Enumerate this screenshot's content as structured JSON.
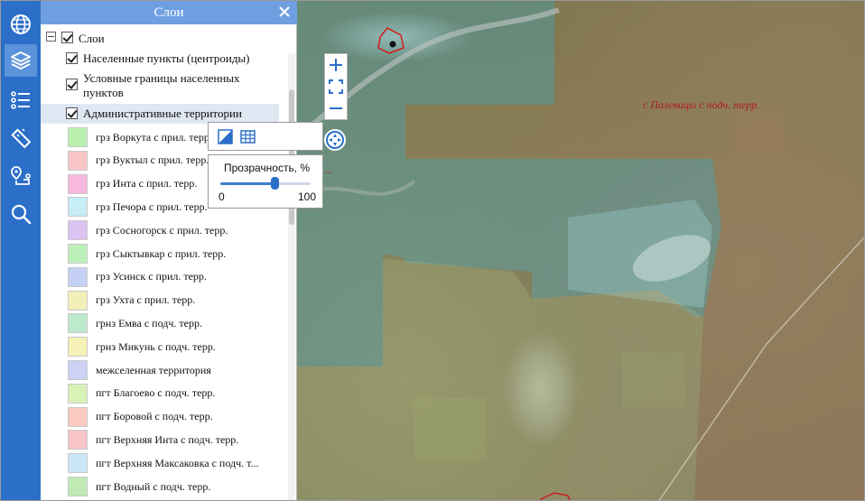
{
  "panel": {
    "title": "Слои",
    "root_label": "Слои",
    "layers": [
      {
        "label": "Населенные пункты (центроиды)"
      },
      {
        "label": "Условные границы населенных пунктов"
      },
      {
        "label": "Административные территории"
      }
    ]
  },
  "legend": [
    {
      "label": "грз Воркута с прил. терр.",
      "color": "#b9f0b0"
    },
    {
      "label": "грз Вуктыл с прил. терр.",
      "color": "#f9c6c6"
    },
    {
      "label": "грз Инта с прил. терр.",
      "color": "#f7b8de"
    },
    {
      "label": "грз Печора с прил. терр.",
      "color": "#c6eef4"
    },
    {
      "label": "грз Сосногорск с прил. терр.",
      "color": "#dcc3f2"
    },
    {
      "label": "грз Сыктывкар с прил. терр.",
      "color": "#bdefb9"
    },
    {
      "label": "грз Усинск с прил. терр.",
      "color": "#c5d1f4"
    },
    {
      "label": "грз Ухта с прил. терр.",
      "color": "#f3efb9"
    },
    {
      "label": "грнз Емва с подч. терр.",
      "color": "#bde9cc"
    },
    {
      "label": "грнз Микунь с подч. терр.",
      "color": "#f6f1b6"
    },
    {
      "label": "межселенная территория",
      "color": "#cdd1f5"
    },
    {
      "label": "пгт Благоево с подч. терр.",
      "color": "#d9f2b8"
    },
    {
      "label": "пгт Боровой с подч. терр.",
      "color": "#f9c9c2"
    },
    {
      "label": "пгт Верхняя Инта с подч. терр.",
      "color": "#f7c4c8"
    },
    {
      "label": "пгт Верхняя Максаковка с подч. т...",
      "color": "#cbe6f6"
    },
    {
      "label": "пгт Водный с подч. терр.",
      "color": "#bfeab4"
    }
  ],
  "opacity": {
    "title": "Прозрачность, %",
    "min": "0",
    "max": "100",
    "value": 60
  },
  "map": {
    "labels": [
      "с Палевицы с подч. терр."
    ]
  }
}
